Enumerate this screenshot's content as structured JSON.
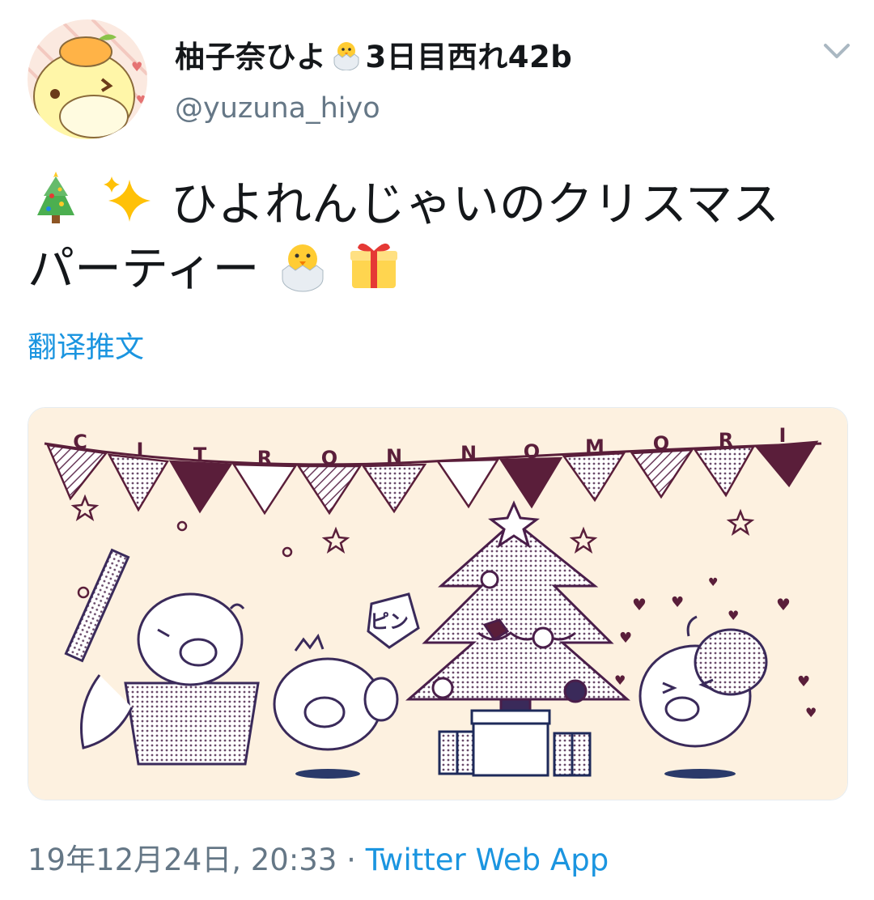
{
  "user": {
    "display_name": "柚子奈ひよ",
    "display_name_suffix": "3日目西れ42b",
    "handle": "@yuzuna_hiyo"
  },
  "tweet": {
    "line1": "ひよれんじゃいのクリスマス",
    "line2": "パーティー",
    "translate_label": "翻译推文"
  },
  "image": {
    "banner_letters": [
      "C",
      "I",
      "T",
      "R",
      "O",
      "N",
      "N",
      "O",
      "M",
      "O",
      "R",
      "I"
    ],
    "sound_effect": "ピン"
  },
  "meta": {
    "timestamp": "19年12月24日, 20:33",
    "separator": "·",
    "source": "Twitter Web App"
  },
  "icons": [
    "avatar-chick-icon",
    "chevron-down-icon",
    "christmas-tree-icon",
    "sparkles-icon",
    "hatching-chick-icon",
    "gift-icon"
  ],
  "colors": {
    "link": "#1b95e0",
    "secondary": "#657786",
    "image_bg": "#fdf1e0",
    "ink": "#5a1e3a"
  }
}
